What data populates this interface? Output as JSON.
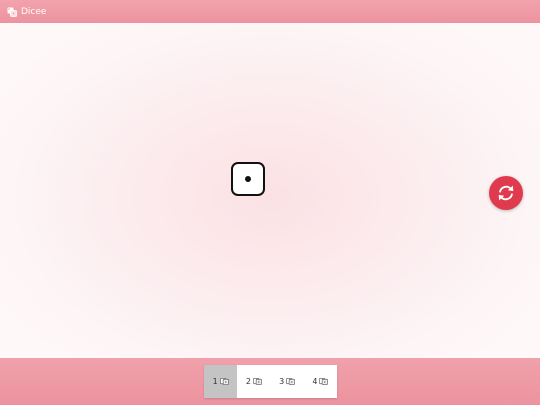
{
  "window": {
    "title": "Dicee",
    "icon": "dice-app-icon"
  },
  "main": {
    "die": {
      "face_value": 1
    }
  },
  "roll_button": {
    "icon": "refresh-icon",
    "color": "#e03a4e"
  },
  "dice_count_selector": {
    "selected": "1",
    "options": [
      {
        "label": "1",
        "icon": "dice-icon"
      },
      {
        "label": "2",
        "icon": "dice-icon"
      },
      {
        "label": "3",
        "icon": "dice-icon"
      },
      {
        "label": "4",
        "icon": "dice-icon"
      }
    ]
  },
  "colors": {
    "header": "#ec939f",
    "background_center": "#fbe1e4",
    "background_edge": "#fef8f8",
    "accent": "#e03a4e",
    "selected_segment": "#c4c4c4"
  }
}
